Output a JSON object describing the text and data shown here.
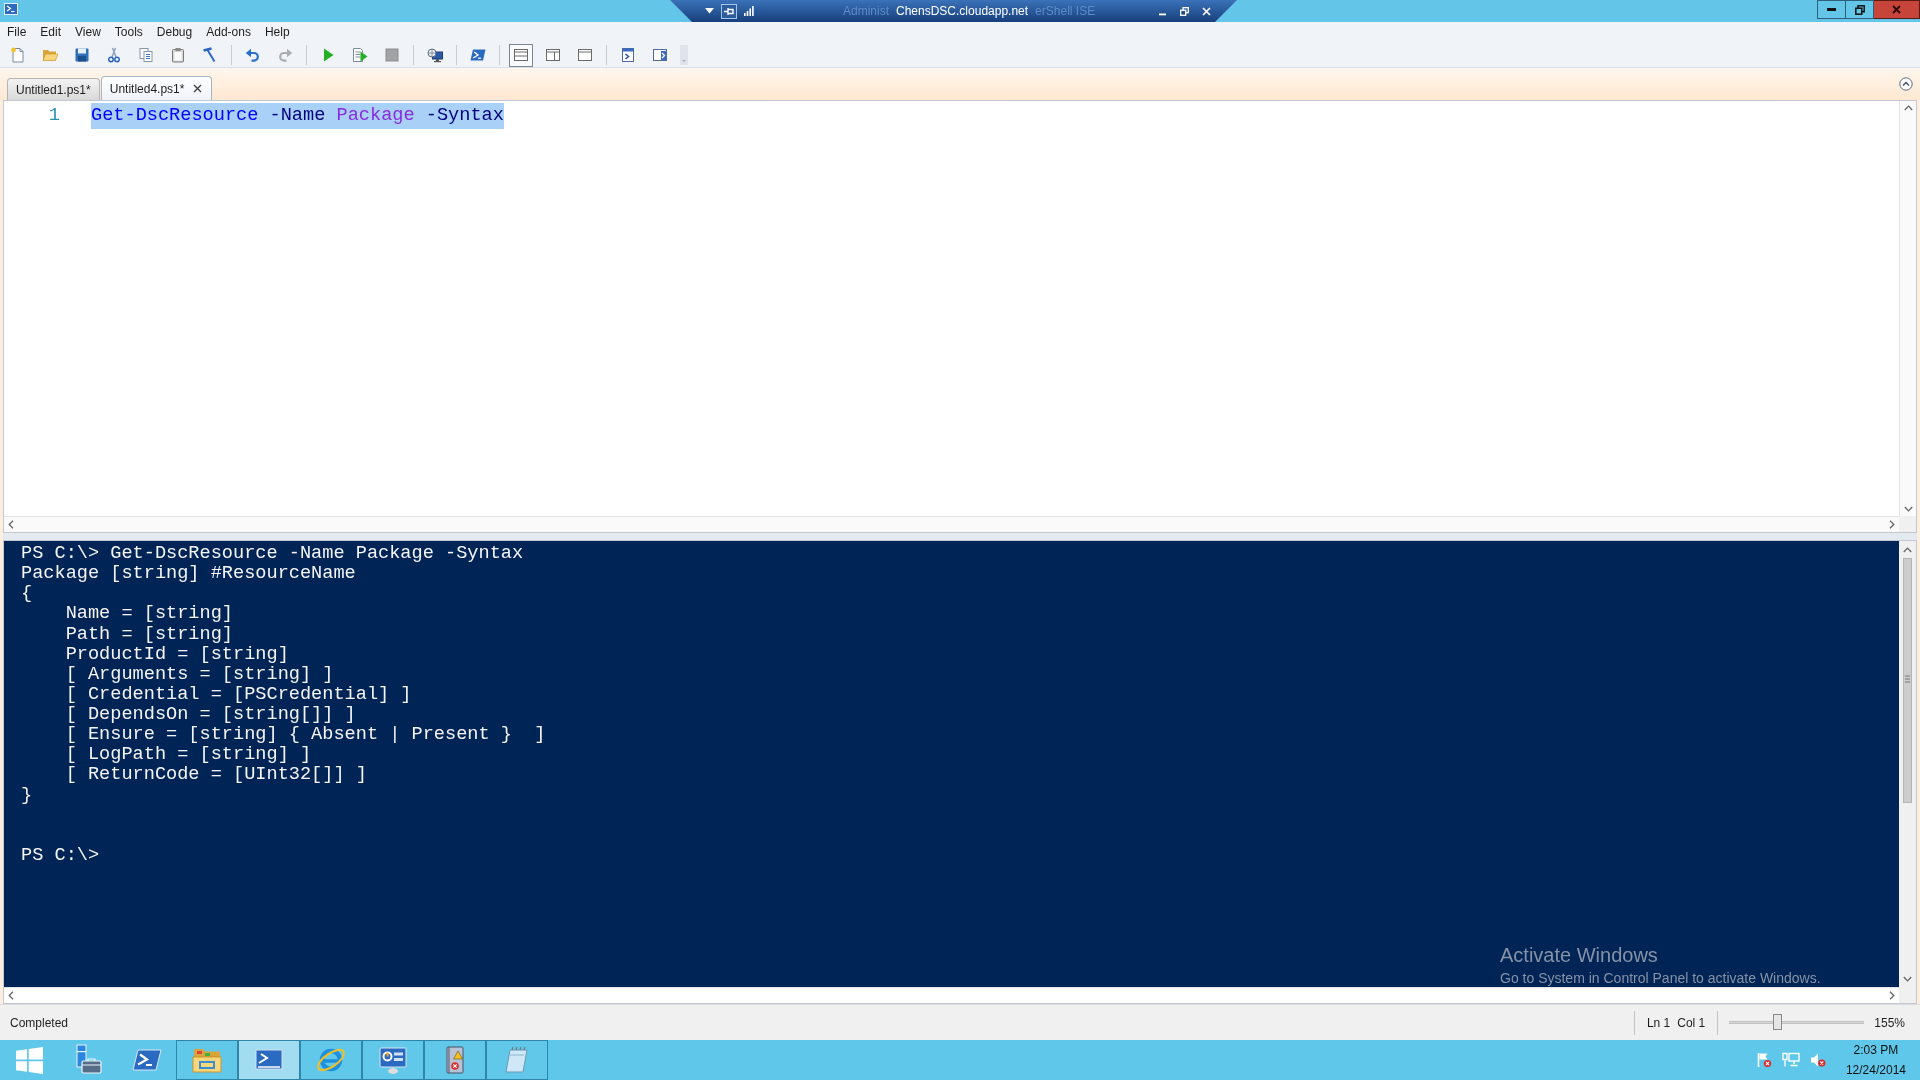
{
  "title_bar": {
    "title_fragments": [
      "Administ",
      "erShell ISE"
    ],
    "connection_bar": {
      "host": "ChensDSC.cloudapp.net",
      "pinned": true
    }
  },
  "menu": [
    "File",
    "Edit",
    "View",
    "Tools",
    "Debug",
    "Add-ons",
    "Help"
  ],
  "toolbar": {
    "groups": [
      [
        {
          "kind": "new",
          "disabled": false
        },
        {
          "kind": "open",
          "disabled": false
        },
        {
          "kind": "save",
          "disabled": false
        },
        {
          "kind": "cut",
          "disabled": false
        },
        {
          "kind": "copy",
          "disabled": false
        },
        {
          "kind": "paste",
          "disabled": false
        },
        {
          "kind": "clear",
          "disabled": false
        }
      ],
      [
        {
          "kind": "undo",
          "disabled": false
        },
        {
          "kind": "redo",
          "disabled": true
        }
      ],
      [
        {
          "kind": "run",
          "disabled": false
        },
        {
          "kind": "run_selection",
          "disabled": false
        },
        {
          "kind": "stop",
          "disabled": true
        }
      ],
      [
        {
          "kind": "remote",
          "disabled": false
        }
      ],
      [
        {
          "kind": "console",
          "disabled": false
        }
      ],
      [
        {
          "kind": "pane_top",
          "disabled": false,
          "selected": true
        },
        {
          "kind": "pane_right",
          "disabled": false,
          "selected": false
        },
        {
          "kind": "pane_max",
          "disabled": false,
          "selected": false
        }
      ],
      [
        {
          "kind": "commands",
          "disabled": false
        },
        {
          "kind": "addon",
          "disabled": false
        }
      ]
    ]
  },
  "tabs": [
    {
      "label": "Untitled1.ps1*",
      "selected": false
    },
    {
      "label": "Untitled4.ps1*",
      "selected": true
    }
  ],
  "editor": {
    "lines": [
      {
        "number": "1",
        "selected": true,
        "tokens": [
          {
            "kind": "command",
            "text": "Get-DscResource"
          },
          {
            "kind": "parameter",
            "text": "-Name"
          },
          {
            "kind": "argument",
            "text": "Package"
          },
          {
            "kind": "parameter",
            "text": "-Syntax"
          }
        ]
      }
    ]
  },
  "console": {
    "lines": [
      {
        "text": "PS C:\\> Get-DscResource -Name Package -Syntax"
      },
      {
        "text": "Package [string] #ResourceName"
      },
      {
        "text": "{",
        "children": [
          {
            "text": "Name = [string]"
          },
          {
            "text": "Path = [string]"
          },
          {
            "text": "ProductId = [string]"
          },
          {
            "text": "[ Arguments = [string] ]"
          },
          {
            "text": "[ Credential = [PSCredential] ]"
          },
          {
            "text": "[ DependsOn = [string[]] ]"
          },
          {
            "text": "[ Ensure = [string] { Absent | Present }  ]"
          },
          {
            "text": "[ LogPath = [string] ]"
          },
          {
            "text": "[ ReturnCode = [UInt32[]] ]"
          }
        ]
      },
      {
        "text": "}"
      }
    ],
    "prompt": "PS C:\\>"
  },
  "activation_notice": {
    "title": "Activate Windows",
    "message": "Go to System in Control Panel to activate Windows."
  },
  "status_bar": {
    "status": "Completed",
    "line": "Ln 1",
    "column": "Col 1",
    "zoom": {
      "level": 0.36,
      "reading": "155%"
    }
  },
  "taskbar": {
    "apps": [
      {
        "kind": "server_manager",
        "running": false,
        "selected": false
      },
      {
        "kind": "powershell",
        "running": false,
        "selected": false
      },
      {
        "kind": "explorer",
        "running": true,
        "selected": false
      },
      {
        "kind": "ise",
        "running": true,
        "selected": true
      },
      {
        "kind": "browser",
        "running": true,
        "selected": false
      },
      {
        "kind": "control_panel",
        "running": true,
        "selected": false
      },
      {
        "kind": "event_viewer",
        "running": true,
        "selected": false
      },
      {
        "kind": "notepad",
        "running": true,
        "selected": false
      }
    ],
    "clock": {
      "time": "2:03 PM",
      "date": "12/24/2014"
    }
  }
}
